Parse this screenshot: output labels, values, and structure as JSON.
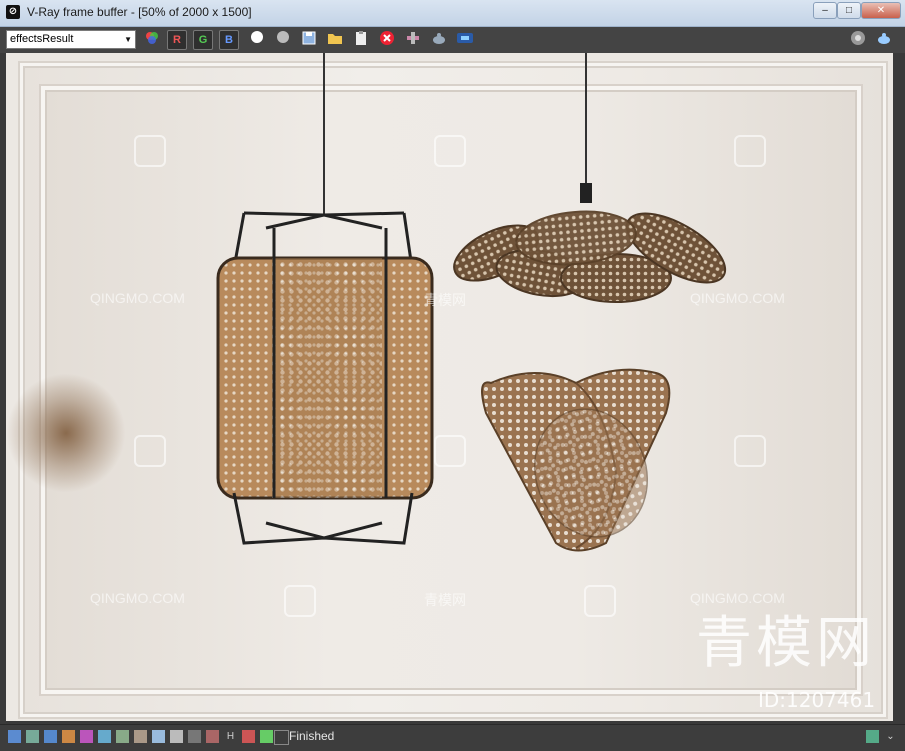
{
  "window": {
    "title": "V-Ray frame buffer - [50% of 2000 x 1500]",
    "app_icon": "vray-logo-icon",
    "controls": [
      "minimize",
      "maximize",
      "close"
    ]
  },
  "toolbar": {
    "channel_select": "effectsResult",
    "red_label": "R",
    "green_label": "G",
    "blue_label": "B",
    "icons": [
      "color-wheel-icon",
      "red-channel",
      "green-channel",
      "blue-channel",
      "white-dot-icon",
      "gray-dot-icon",
      "save-icon",
      "open-folder-icon",
      "clipboard-icon",
      "clear-icon",
      "region-icon",
      "teapot-icon",
      "lens-icon",
      "render-settings-icon",
      "render-teapot-icon"
    ]
  },
  "watermark": {
    "site": "QINGMO.COM",
    "chinese_small": "青模网",
    "chinese_big": "青模网",
    "id": "ID:1207461"
  },
  "status": {
    "text": "Finished"
  }
}
